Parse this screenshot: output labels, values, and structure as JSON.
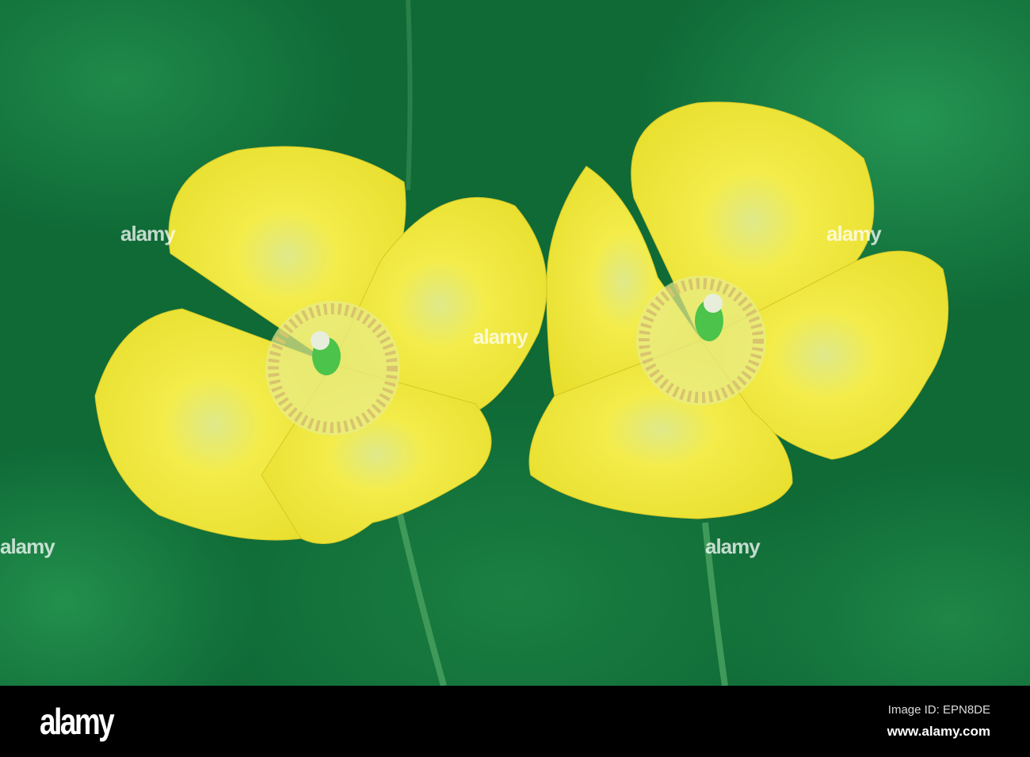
{
  "photo": {
    "subject": "two yellow poppies",
    "colors": {
      "background": "#0f6a36",
      "petal": "#f2ea3a",
      "center": "#4cc34a"
    }
  },
  "watermark": {
    "text": "alamy"
  },
  "footer": {
    "logo": "alamy",
    "image_id": "Image ID: EPN8DE",
    "website": "www.alamy.com"
  }
}
